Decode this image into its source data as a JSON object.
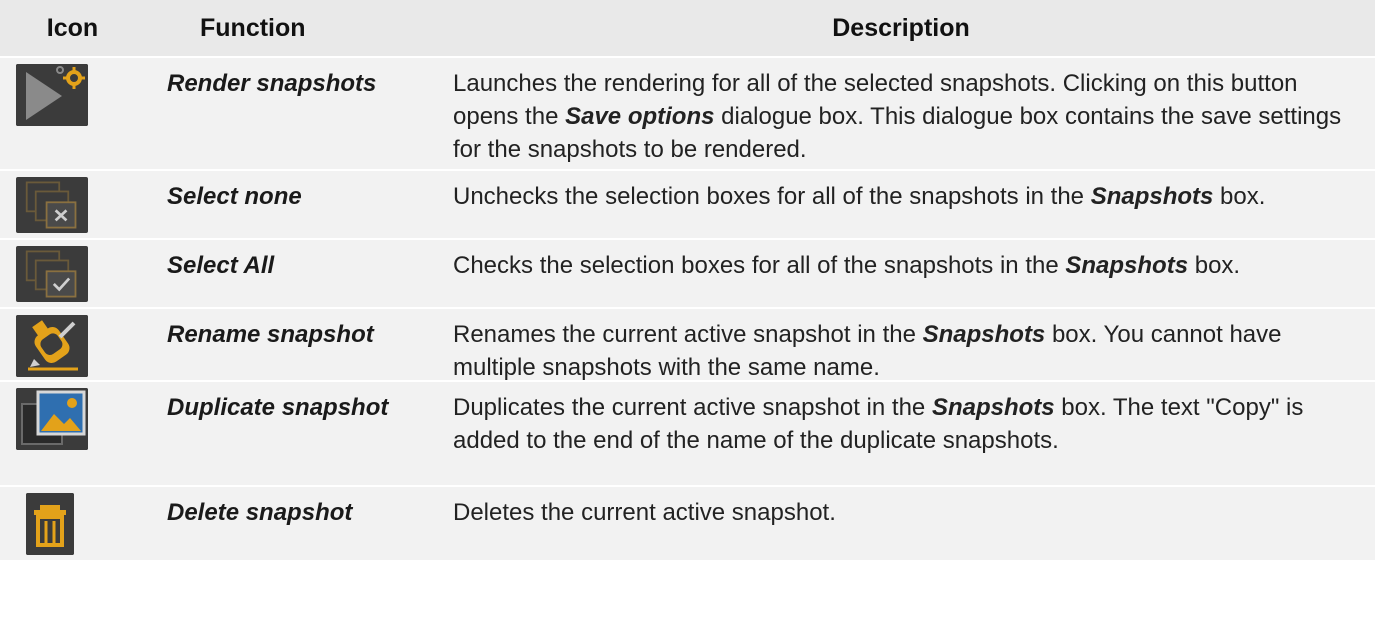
{
  "headers": {
    "icon": "Icon",
    "function": "Function",
    "description": "Description"
  },
  "rows": [
    {
      "icon": "render-snapshots-icon",
      "function": "Render snapshots",
      "desc_1": "Launches the rendering for all of the selected snapshots. Clicking on this button opens the ",
      "desc_em": "Save options",
      "desc_2": " dialogue box. This dialogue box contains the save settings for the snapshots to be rendered."
    },
    {
      "icon": "select-none-icon",
      "function": "Select none",
      "desc_1": "Unchecks the selection boxes for all of the snapshots in the ",
      "desc_em": "Snapshots",
      "desc_2": " box."
    },
    {
      "icon": "select-all-icon",
      "function": "Select All",
      "desc_1": "Checks the selection boxes for all of the snapshots in the ",
      "desc_em": "Snapshots",
      "desc_2": " box."
    },
    {
      "icon": "rename-snapshot-icon",
      "function": "Rename snapshot",
      "desc_1": "Renames the current active snapshot in the ",
      "desc_em": "Snapshots",
      "desc_2": " box. You cannot have multiple snapshots with the same name."
    },
    {
      "icon": "duplicate-snapshot-icon",
      "function": "Duplicate snapshot",
      "desc_1": "Duplicates the current active snapshot in the ",
      "desc_em": "Snapshots",
      "desc_2": " box. The text \"Copy\" is added to the end of the name of the duplicate snapshots."
    },
    {
      "icon": "delete-snapshot-icon",
      "function": "Delete snapshot",
      "desc_1": "Deletes the current active snapshot.",
      "desc_em": "",
      "desc_2": ""
    }
  ],
  "colors": {
    "header_bg": "#e9e9e9",
    "row_bg": "#f2f2f2",
    "icon_bg": "#3b3b3b",
    "icon_accent": "#e3a21a",
    "icon_gray": "#8a8a8a"
  }
}
